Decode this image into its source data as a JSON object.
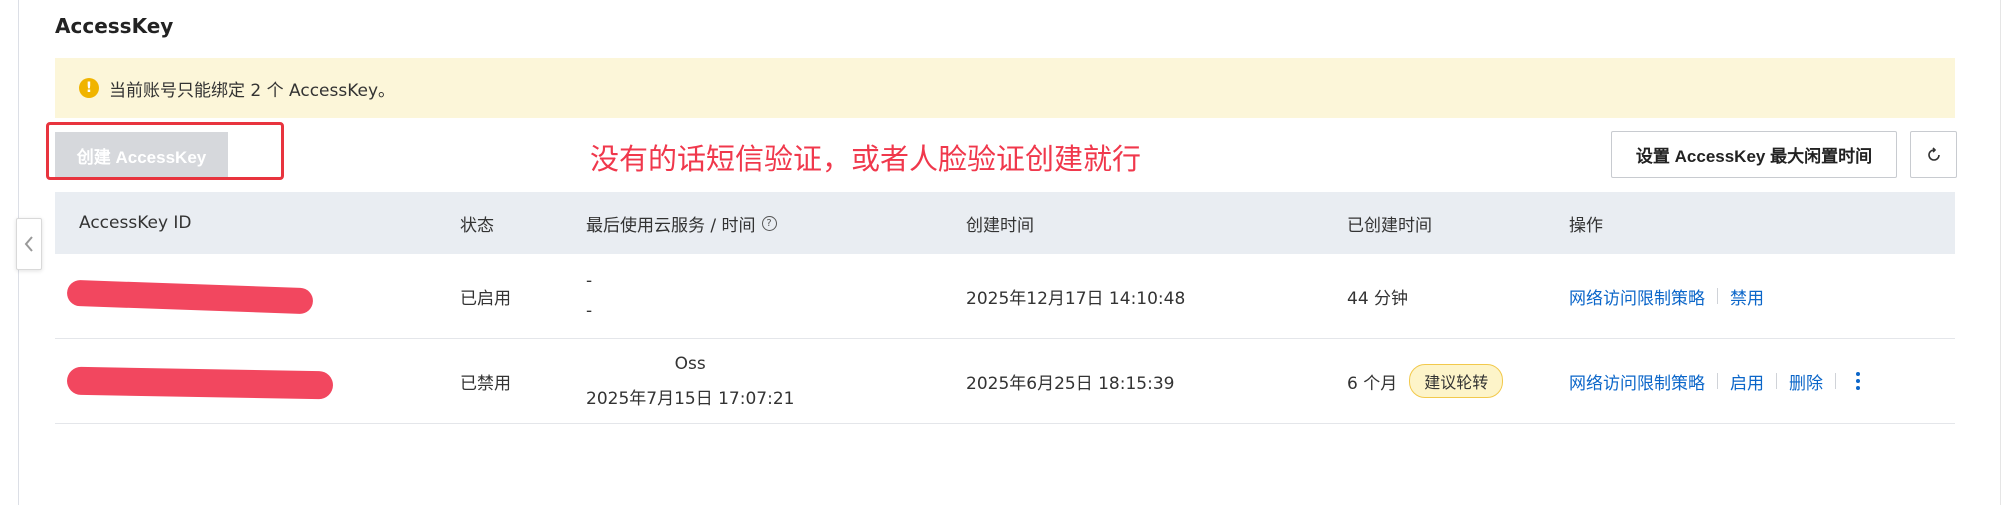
{
  "header": {
    "title": "AccessKey"
  },
  "notice": {
    "text": "当前账号只能绑定 2 个 AccessKey。"
  },
  "toolbar": {
    "create_label": "创建 AccessKey",
    "set_idle_label": "设置 AccessKey 最大闲置时间"
  },
  "annotation": {
    "text": "没有的话短信验证，或者人脸验证创建就行"
  },
  "table": {
    "headers": {
      "id": "AccessKey ID",
      "status": "状态",
      "last_used": "最后使用云服务 / 时间",
      "created_time": "创建时间",
      "age": "已创建时间",
      "actions": "操作"
    },
    "rows": [
      {
        "status": "已启用",
        "last_service": "-",
        "last_time": "-",
        "created_time": "2025年12月17日 14:10:48",
        "age": "44 分钟",
        "action_policy": "网络访问限制策略",
        "action_toggle": "禁用"
      },
      {
        "status": "已禁用",
        "last_service": "Oss",
        "last_time": "2025年7月15日 17:07:21",
        "created_time": "2025年6月25日 18:15:39",
        "age": "6 个月",
        "badge": "建议轮转",
        "action_policy": "网络访问限制策略",
        "action_toggle": "启用",
        "action_delete": "删除"
      }
    ]
  },
  "colors": {
    "annotation": "#f0384c",
    "link": "#0b66c9",
    "notice_bg": "#fcf6d9",
    "header_bg": "#e9edf2",
    "redaction": "#f2475f"
  }
}
